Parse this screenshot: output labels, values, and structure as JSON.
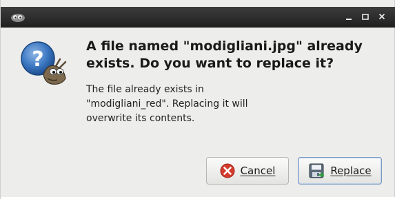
{
  "window": {
    "controls": [
      "minimize-icon",
      "maximize-icon",
      "close-icon"
    ]
  },
  "dialog": {
    "icon": "question-wilber-icon",
    "heading_line1": "A file named \"modigliani.jpg\" already",
    "heading_line2": "exists.  Do you want to replace it?",
    "message_line1": "The file already exists in",
    "message_line2": "\"modigliani_red\".  Replacing it will",
    "message_line3": "overwrite its contents."
  },
  "buttons": {
    "cancel_label": "Cancel",
    "cancel_icon": "cancel-icon",
    "replace_label": "Replace",
    "replace_icon": "save-icon"
  },
  "colors": {
    "titlebar": "#2b2b2b",
    "dialog_bg": "#ededeb",
    "question_blue": "#2f6db5",
    "cancel_red": "#d33b2c",
    "replace_accent": "#7a99c4"
  }
}
